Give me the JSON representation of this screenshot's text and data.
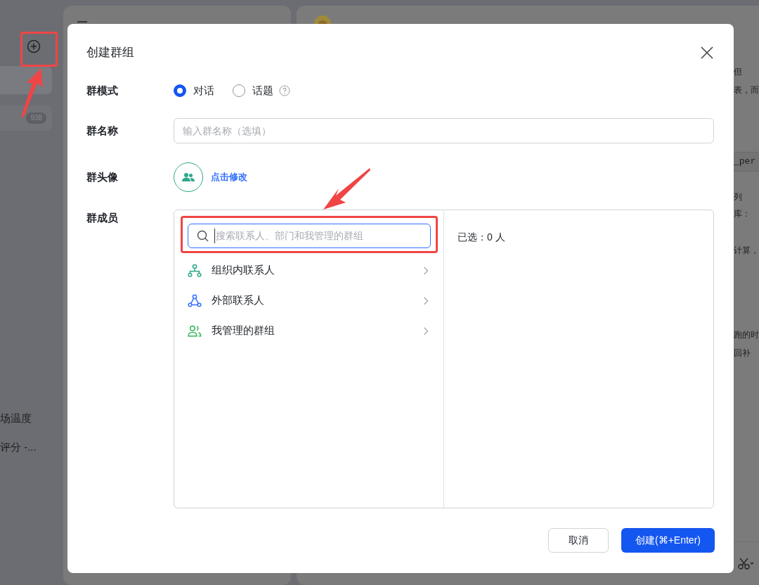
{
  "sidebar": {
    "unread_badge": "938",
    "items": [
      {
        "text": "场温度"
      },
      {
        "text": "评分 -..."
      }
    ]
  },
  "chat": {
    "fragments": [
      {
        "kind": "text",
        "text": "但"
      },
      {
        "kind": "text",
        "text": "表，而"
      },
      {
        "kind": "code",
        "text": "_per"
      },
      {
        "kind": "text",
        "text": "列"
      },
      {
        "kind": "text",
        "text": "库："
      },
      {
        "kind": "text",
        "text": "计算，"
      },
      {
        "kind": "text",
        "text": "跑的时"
      },
      {
        "kind": "text",
        "text": "回补"
      }
    ]
  },
  "dialog": {
    "title": "创建群组",
    "mode": {
      "label": "群模式",
      "options": [
        {
          "label": "对话",
          "selected": true
        },
        {
          "label": "话题",
          "selected": false
        }
      ]
    },
    "name": {
      "label": "群名称",
      "placeholder": "输入群名称（选填）"
    },
    "avatar": {
      "label": "群头像",
      "link": "点击修改"
    },
    "members": {
      "label": "群成员",
      "search_placeholder": "搜索联系人、部门和我管理的群组",
      "categories": [
        {
          "kind": "org",
          "label": "组织内联系人"
        },
        {
          "kind": "external",
          "label": "外部联系人"
        },
        {
          "kind": "groups",
          "label": "我管理的群组"
        }
      ],
      "selected_count": "已选：0 人"
    },
    "buttons": {
      "cancel": "取消",
      "create": "创建(⌘+Enter)"
    }
  }
}
